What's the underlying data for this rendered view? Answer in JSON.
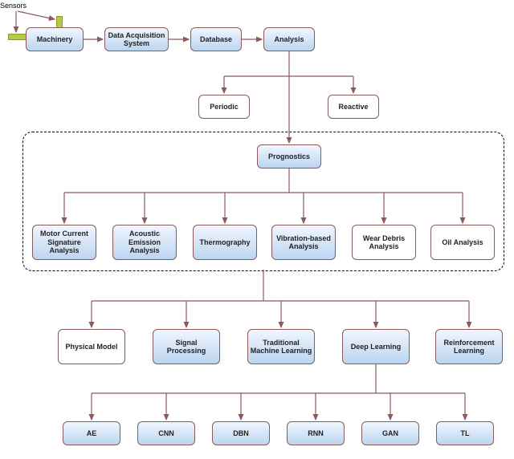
{
  "labels": {
    "sensors": "Sensors",
    "machinery": "Machinery",
    "daq": "Data Acquisition System",
    "database": "Database",
    "analysis": "Analysis",
    "periodic": "Periodic",
    "reactive": "Reactive",
    "prognostics": "Prognostics",
    "mcsa": "Motor Current Signature Analysis",
    "acoustic": "Acoustic Emission Analysis",
    "thermo": "Thermography",
    "vibration": "Vibration-based Analysis",
    "wear": "Wear Debris Analysis",
    "oil": "Oil Analysis",
    "physical": "Physical Model",
    "signal": "Signal Processing",
    "tradml": "Traditional Machine Learning",
    "deepl": "Deep Learning",
    "reinf": "Reinforcement Learning",
    "ae": "AE",
    "cnn": "CNN",
    "dbn": "DBN",
    "rnn": "RNN",
    "gan": "GAN",
    "tl": "TL"
  },
  "edges": [
    {
      "from": "machinery",
      "to": "daq",
      "type": "h"
    },
    {
      "from": "daq",
      "to": "database",
      "type": "h"
    },
    {
      "from": "database",
      "to": "analysis",
      "type": "h"
    },
    {
      "from": "analysis",
      "to": "periodic",
      "type": "branch"
    },
    {
      "from": "analysis",
      "to": "reactive",
      "type": "branch"
    },
    {
      "from": "analysis",
      "to": "prognostics",
      "type": "v"
    },
    {
      "from": "prognostics",
      "to": "mcsa",
      "type": "branch"
    },
    {
      "from": "prognostics",
      "to": "acoustic",
      "type": "branch"
    },
    {
      "from": "prognostics",
      "to": "thermo",
      "type": "branch"
    },
    {
      "from": "prognostics",
      "to": "vibration",
      "type": "branch"
    },
    {
      "from": "prognostics",
      "to": "wear",
      "type": "branch"
    },
    {
      "from": "prognostics",
      "to": "oil",
      "type": "branch"
    },
    {
      "from": "prognostics",
      "to": "physical",
      "type": "branch2"
    },
    {
      "from": "prognostics",
      "to": "signal",
      "type": "branch2"
    },
    {
      "from": "prognostics",
      "to": "tradml",
      "type": "branch2"
    },
    {
      "from": "prognostics",
      "to": "deepl",
      "type": "branch2"
    },
    {
      "from": "prognostics",
      "to": "reinf",
      "type": "branch2"
    },
    {
      "from": "deepl",
      "to": "ae",
      "type": "branch3"
    },
    {
      "from": "deepl",
      "to": "cnn",
      "type": "branch3"
    },
    {
      "from": "deepl",
      "to": "dbn",
      "type": "branch3"
    },
    {
      "from": "deepl",
      "to": "rnn",
      "type": "branch3"
    },
    {
      "from": "deepl",
      "to": "gan",
      "type": "branch3"
    },
    {
      "from": "deepl",
      "to": "tl",
      "type": "branch3"
    }
  ],
  "colors": {
    "line": "#8b5a5a",
    "sensor": "#b8c94a"
  }
}
